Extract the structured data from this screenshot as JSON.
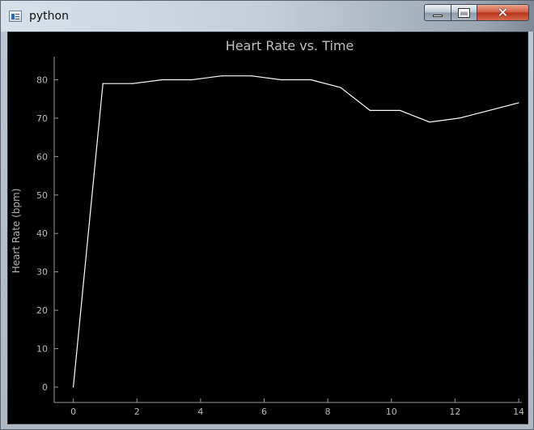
{
  "window": {
    "title": "python",
    "controls": {
      "minimize": "minimize",
      "maximize": "maximize",
      "close": "close"
    }
  },
  "chart_data": {
    "type": "line",
    "title": "Heart Rate vs. Time",
    "xlabel": "",
    "ylabel": "Heart Rate (bpm)",
    "xlim": [
      -0.6,
      14.1
    ],
    "ylim": [
      -4,
      86
    ],
    "xticks": [
      0,
      2,
      4,
      6,
      8,
      10,
      12,
      14
    ],
    "yticks": [
      0,
      10,
      20,
      30,
      40,
      50,
      60,
      70,
      80
    ],
    "grid": false,
    "colors": {
      "background": "#000000",
      "line": "#ffffff",
      "axis": "#9a9a9a",
      "text": "#b8b8b8"
    },
    "x": [
      0,
      0.93,
      1.87,
      2.8,
      3.73,
      4.67,
      5.6,
      6.53,
      7.47,
      8.4,
      9.33,
      10.27,
      11.2,
      12.13,
      13.07,
      14
    ],
    "y": [
      0,
      79,
      79,
      80,
      80,
      81,
      81,
      80,
      80,
      78,
      72,
      72,
      69,
      70,
      72,
      74
    ]
  }
}
